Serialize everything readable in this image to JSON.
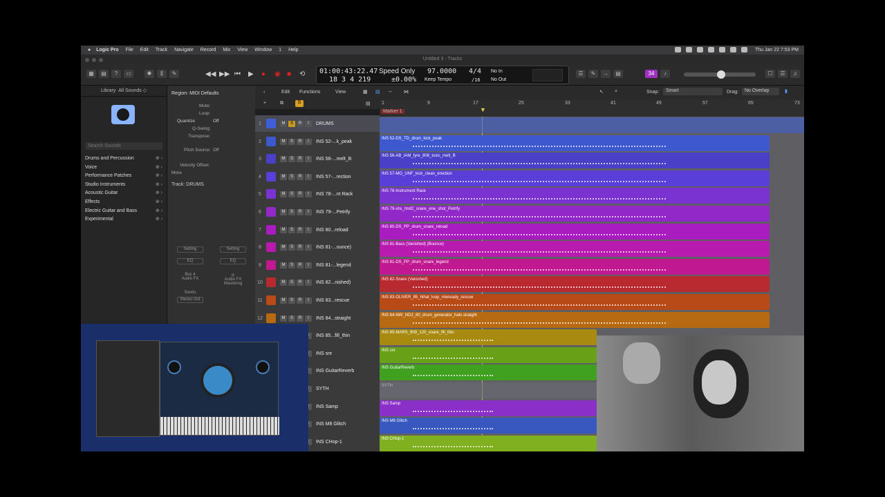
{
  "menubar": {
    "app": "Logic Pro",
    "items": [
      "File",
      "Edit",
      "Track",
      "Navigate",
      "Record",
      "Mix",
      "View",
      "Window",
      "1",
      "Help"
    ],
    "clock": "Thu Jan 22  7:53 PM"
  },
  "window": {
    "title": "Untitled 3 - Tracks"
  },
  "lcd": {
    "time": "01:00:43:22.47",
    "bars": "18  3  4  219",
    "mode": "Speed Only",
    "percent": "±0.00%",
    "tempo": "97.0000",
    "tempo_label": "Keep Tempo",
    "sig": "4/4",
    "div": "/16",
    "in": "No In",
    "out": "No Out"
  },
  "library": {
    "title": "Library",
    "filter": "All Sounds ◇",
    "search_placeholder": "Search Sounds",
    "categories": [
      "Drums and Percussion",
      "Voice",
      "Performance Patches",
      "Studio Instruments",
      "Acoustic Guitar",
      "Effects",
      "Electric Guitar and Bass",
      "Experimental"
    ]
  },
  "inspector": {
    "region": "Region: MIDI Defaults",
    "mute": "Mute:",
    "loop": "Loop:",
    "quantize": "Quantize",
    "quantize_val": "Off",
    "qswing": "Q-Swing:",
    "transpose": "Transpose:",
    "pitch": "Pitch Source:",
    "pitch_val": "Off",
    "velocity": "Velocity Offset:",
    "more": "More",
    "track": "Track:",
    "track_val": "DRUMS",
    "setting": "Setting",
    "eq": "EQ",
    "bus": "Bus 4",
    "audiofx": "Audio FX",
    "mastering": "Audio FX\nMastering",
    "sends": "Sends",
    "stereo": "Stereo Out"
  },
  "toolbar": {
    "edit": "Edit",
    "functions": "Functions",
    "view": "View",
    "snap_label": "Snap:",
    "snap": "Smart",
    "drag_label": "Drag:",
    "drag": "No Overlap",
    "badge": "34"
  },
  "ruler": {
    "ticks": [
      "1",
      "9",
      "17",
      "25",
      "33",
      "41",
      "49",
      "57",
      "65",
      "73"
    ],
    "marker": "Marker 1"
  },
  "tracks": [
    {
      "n": "1",
      "name": "DRUMS",
      "color": "#3e5fd8",
      "region": "",
      "folder": true
    },
    {
      "n": "2",
      "name": "INS 52-...k_peak",
      "color": "#3e58d0",
      "region": "INS 52-DS_TD_drum_kick_peak"
    },
    {
      "n": "3",
      "name": "INS 56-...melt_B",
      "color": "#4a40c8",
      "region": "INS 56-AB_IAM_fyre_808_toxic_melt_B"
    },
    {
      "n": "4",
      "name": "INS 57-...rection",
      "color": "#5a3ed8",
      "region": "INS 57-MO_UNF_kick_clean_erection"
    },
    {
      "n": "5",
      "name": "INS 78-...nt Rack",
      "color": "#7a32d0",
      "region": "INS 78-Instrument Rack"
    },
    {
      "n": "6",
      "name": "INS 79-...Petrify",
      "color": "#9228c8",
      "region": "INS 79-shs_tmd2_snare_one_shot_Petrify"
    },
    {
      "n": "7",
      "name": "INS 80...reload",
      "color": "#a81cc0",
      "region": "INS 80-DS_PP_drum_snare_reload"
    },
    {
      "n": "8",
      "name": "INS 81-...ounce)",
      "color": "#b81ab0",
      "region": "INS 81-Bass (Vanished) (Bounce)"
    },
    {
      "n": "9",
      "name": "INS 81-...legend",
      "color": "#bf1890",
      "region": "INS 81-DS_PP_drum_snare_legend"
    },
    {
      "n": "10",
      "name": "INS 82...nished)",
      "color": "#b82a30",
      "region": "INS 82-Snare (Vanished)"
    },
    {
      "n": "11",
      "name": "INS 83...rescue",
      "color": "#b84a18",
      "region": "INS 83-OLIVER_85_hihat_loop_mixready_rescue"
    },
    {
      "n": "12",
      "name": "INS 84...straight",
      "color": "#b86a12",
      "region": "INS 84-NW_ND2_80_drum_generator_hats straight"
    },
    {
      "n": "",
      "name": "INS 85...fill_thin",
      "color": "#a88a10",
      "region": "INS 85-MARS_909_120_snare_fill_thin"
    },
    {
      "n": "",
      "name": "INS snr",
      "color": "#68a018",
      "region": "INS snr"
    },
    {
      "n": "",
      "name": "INS GuitarReverb",
      "color": "#40a020",
      "region": "INS GuitarReverb"
    },
    {
      "n": "",
      "name": "SYTH",
      "color": "#6c6c78",
      "region": "SYTH",
      "folder": true
    },
    {
      "n": "",
      "name": "INS Samp",
      "color": "#8a30c8",
      "region": "INS Samp"
    },
    {
      "n": "",
      "name": "INS M8 Glitch",
      "color": "#3858c0",
      "region": "INS M8 Glitch"
    },
    {
      "n": "",
      "name": "INS CHop-1",
      "color": "#80b020",
      "region": "INS CHop-1"
    }
  ]
}
